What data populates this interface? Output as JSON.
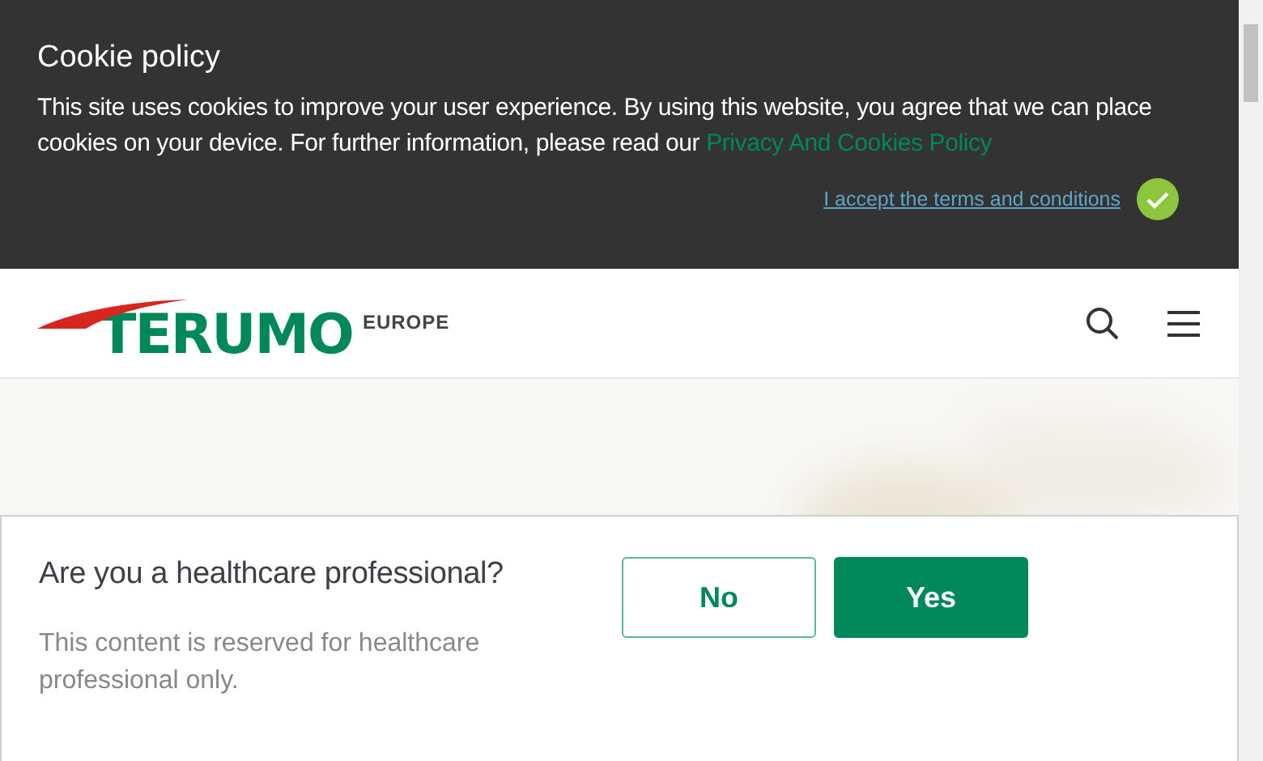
{
  "cookie_banner": {
    "title": "Cookie policy",
    "text": "This site uses cookies to improve your user experience. By using this website, you agree that we can place cookies on your device. For further information, please read our",
    "link": "Privacy And Cookies Policy",
    "accept": "I accept the terms and conditions"
  },
  "header": {
    "logo": "TERUMO",
    "region": "EUROPE"
  },
  "dialog": {
    "question": "Are you a healthcare professional?",
    "note": "This content is reserved for healthcare professional only.",
    "buttons": [
      {
        "label": "No",
        "kind": "outline"
      },
      {
        "label": "Yes",
        "kind": "primary"
      }
    ]
  }
}
